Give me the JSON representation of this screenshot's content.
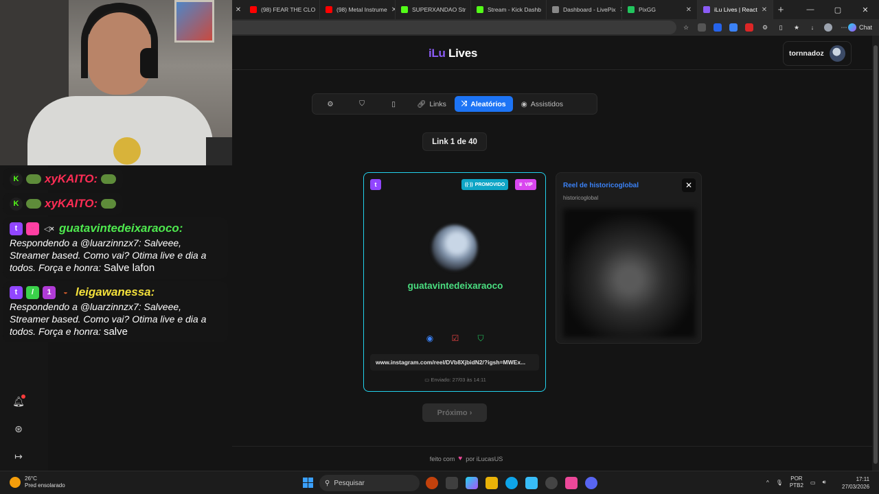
{
  "browser": {
    "tabs": [
      {
        "label": "(98) FEAR THE CLO",
        "color": "#ff0000"
      },
      {
        "label": "(98) Metal Instrume",
        "color": "#ff0000"
      },
      {
        "label": "SUPERXANDAO Str",
        "color": "#53fc18"
      },
      {
        "label": "Stream - Kick Dashb",
        "color": "#53fc18"
      },
      {
        "label": "Dashboard - LivePix",
        "color": "#888888"
      },
      {
        "label": "PixGG",
        "color": "#22c55e"
      },
      {
        "label": "iLu Lives | React",
        "color": "#8b5cf6"
      }
    ],
    "chat_label": "Chat"
  },
  "chat": {
    "messages": [
      {
        "platform": "kick",
        "user": "xyKAITO:",
        "color": "red"
      },
      {
        "platform": "kick",
        "user": "xyKAITO:",
        "color": "red"
      },
      {
        "platform": "twitch",
        "user": "guatavintedeixaraoco:",
        "color": "green",
        "text": "Respondendo a @luarzinnzx7: Salveee, Streamer based. Como vai? Otima live e dia a todos. Força e honra:",
        "reply": "Salve lafon"
      },
      {
        "platform": "twitch",
        "user": "leigawanessa:",
        "color": "yellow",
        "text": "Respondendo a @luarzinnzx7: Salveee, Streamer based. Como vai? Otima live e dia a todos. Força e honra:",
        "reply": "salve"
      }
    ]
  },
  "app": {
    "logo_a": "iLu",
    "logo_b": "Lives",
    "username": "tornnadoz",
    "tabs": {
      "links": "Links",
      "aleatorios": "Aleatórios",
      "assistidos": "Assistidos"
    },
    "counter": "Link 1 de 40",
    "card": {
      "platform_letter": "t",
      "promo": "PROMOVIDO",
      "vip": "VIP",
      "name": "guatavintedeixaraoco",
      "link": "www.instagram.com/reel/DVb8XjbidN2/?igsh=MWEx...",
      "sent": "Enviado: 27/03 às 14:11"
    },
    "preview": {
      "title": "Reel de historicoglobal",
      "subtitle": "historicoglobal",
      "close": "✕"
    },
    "next": "Próximo ›",
    "footer": {
      "before": "feito com",
      "after": "por iLucasUS"
    }
  },
  "taskbar": {
    "temp": "26°C",
    "weather": "Pred ensolarado",
    "search": "Pesquisar",
    "lang1": "POR",
    "lang2": "PTB2",
    "time": "17:11",
    "date": "27/03/2026"
  }
}
